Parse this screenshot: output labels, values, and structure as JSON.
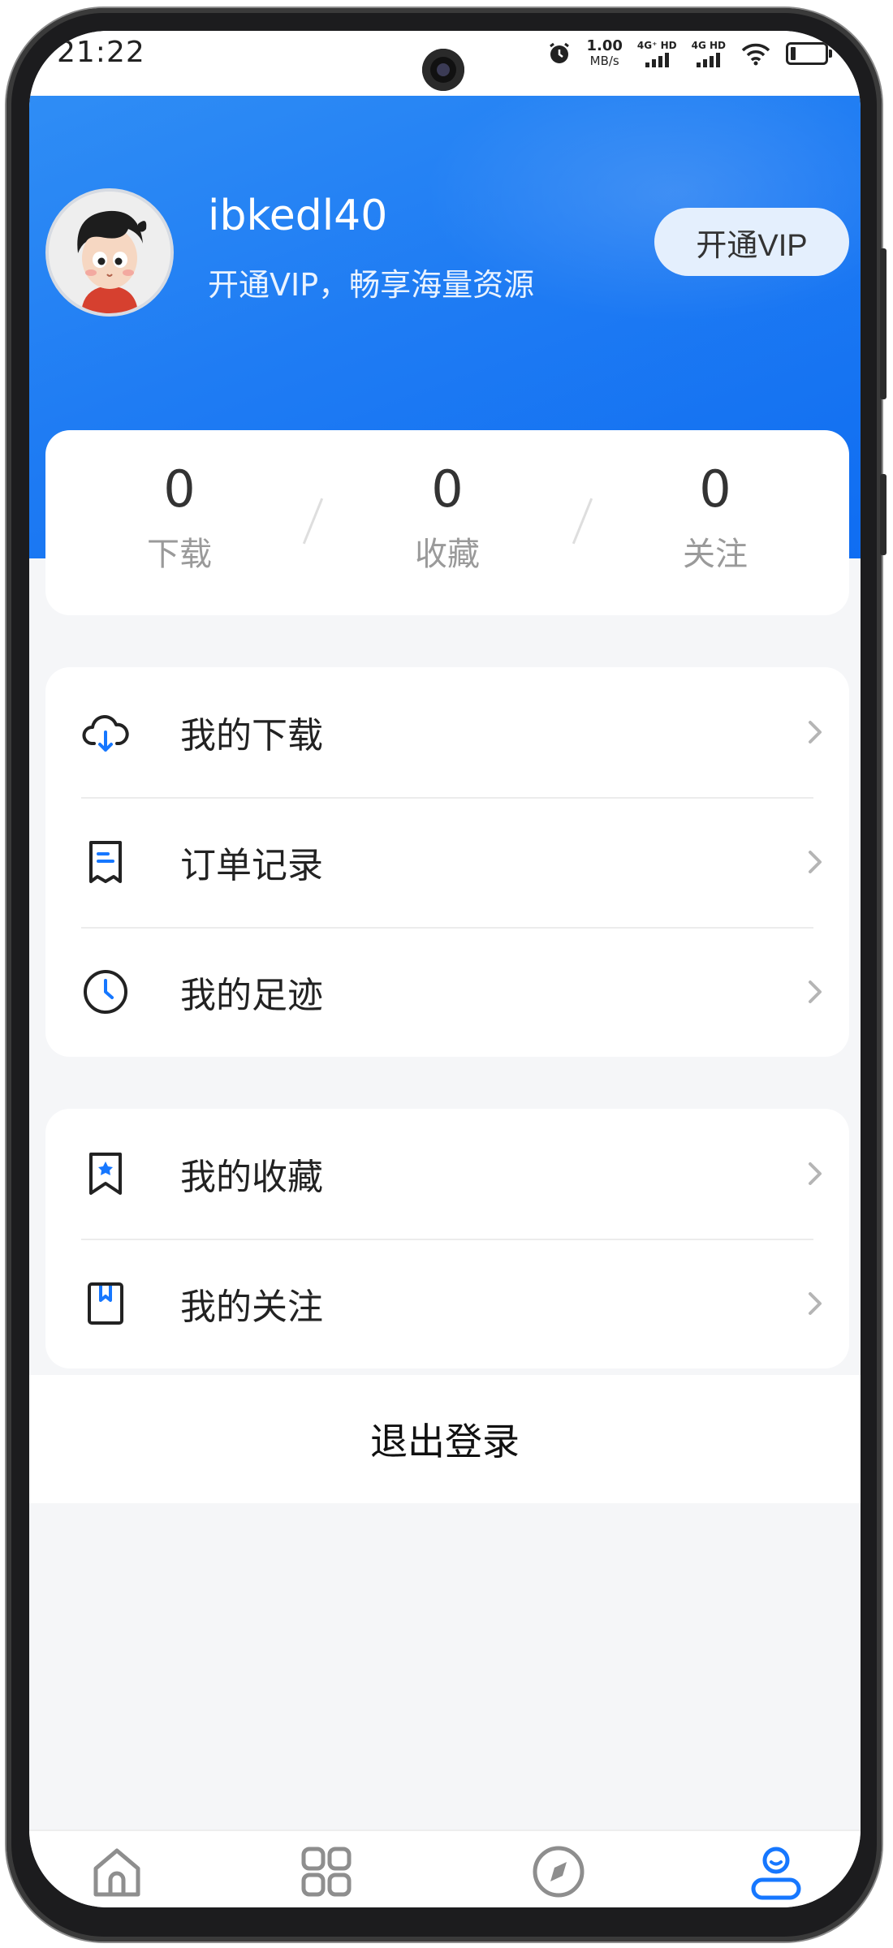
{
  "status_bar": {
    "time": "21:22",
    "net_speed_value": "1.00",
    "net_speed_unit": "MB/s",
    "sim1_label": "4G⁺ HD",
    "sim2_label": "4G HD",
    "icons": [
      "alarm-icon",
      "signal-icon",
      "wifi-icon",
      "battery-icon"
    ]
  },
  "profile": {
    "username": "ibkedl40",
    "subtitle": "开通VIP，畅享海量资源",
    "vip_button": "开通VIP"
  },
  "stats": [
    {
      "value": "0",
      "label": "下载"
    },
    {
      "value": "0",
      "label": "收藏"
    },
    {
      "value": "0",
      "label": "关注"
    }
  ],
  "menu_group_1": [
    {
      "label": "我的下载",
      "icon": "cloud-download-icon"
    },
    {
      "label": "订单记录",
      "icon": "receipt-icon"
    },
    {
      "label": "我的足迹",
      "icon": "clock-icon"
    }
  ],
  "menu_group_2": [
    {
      "label": "我的收藏",
      "icon": "bookmark-star-icon"
    },
    {
      "label": "我的关注",
      "icon": "bookmark-book-icon"
    }
  ],
  "logout_label": "退出登录",
  "tabbar": {
    "tabs": [
      "home-icon",
      "apps-grid-icon",
      "compass-icon",
      "profile-icon"
    ],
    "active_index": 3
  },
  "colors": {
    "header_blue": "#1f7cf3",
    "active_tab": "#1677ff",
    "background": "#f5f6f8"
  }
}
